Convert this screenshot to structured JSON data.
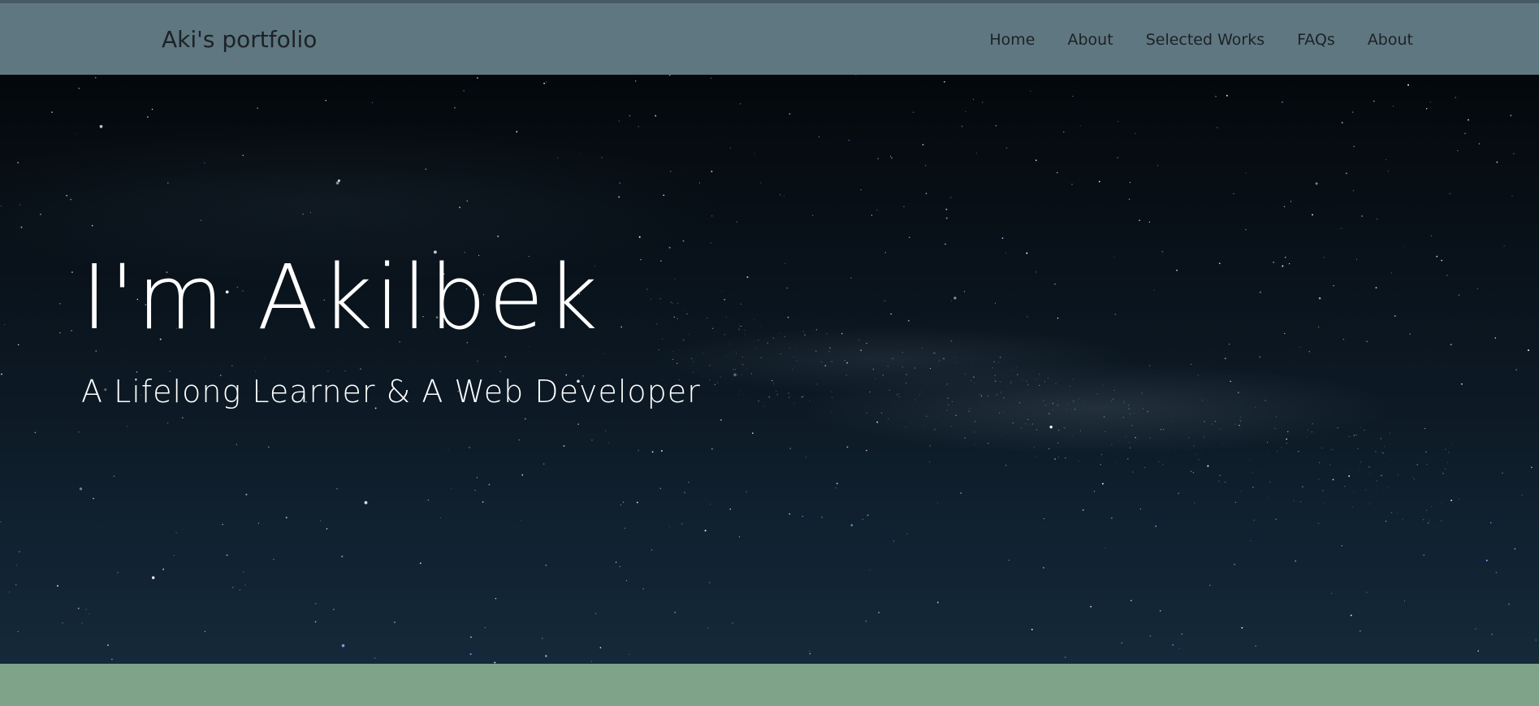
{
  "navbar": {
    "brand": "Aki's portfolio",
    "links": [
      {
        "label": "Home"
      },
      {
        "label": "About"
      },
      {
        "label": "Selected Works"
      },
      {
        "label": "FAQs"
      },
      {
        "label": "About"
      }
    ]
  },
  "hero": {
    "title": "I'm Akilbek",
    "subtitle": "A Lifelong Learner & A Web Developer"
  },
  "colors": {
    "navbar_bg": "#5f7780",
    "hero_bg": "#0b1620",
    "footer_bg": "#7fa389",
    "text_light": "#ffffff",
    "text_dark": "#1c2226"
  }
}
